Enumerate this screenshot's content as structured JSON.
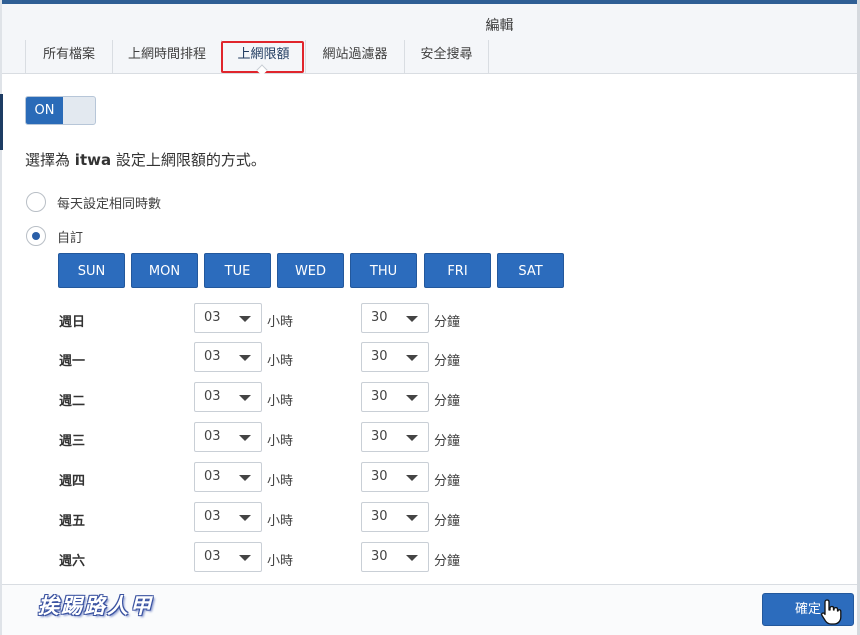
{
  "window": {
    "title": "編輯"
  },
  "tabs": [
    {
      "label": "所有檔案",
      "active": false
    },
    {
      "label": "上網時間排程",
      "active": false
    },
    {
      "label": "上網限額",
      "active": true
    },
    {
      "label": "網站過濾器",
      "active": false
    },
    {
      "label": "安全搜尋",
      "active": false
    }
  ],
  "toggle": {
    "label": "ON",
    "state": "on"
  },
  "prompt": {
    "prefix": "選擇為",
    "user": "itwa",
    "suffix": "設定上網限額的方式。"
  },
  "modes": [
    {
      "label": "每天設定相同時數",
      "checked": false
    },
    {
      "label": "自訂",
      "checked": true
    }
  ],
  "days": [
    "SUN",
    "MON",
    "TUE",
    "WED",
    "THU",
    "FRI",
    "SAT"
  ],
  "units": {
    "hours": "小時",
    "minutes": "分鐘"
  },
  "rows": [
    {
      "label": "週日",
      "hours": "03",
      "minutes": "30"
    },
    {
      "label": "週一",
      "hours": "03",
      "minutes": "30"
    },
    {
      "label": "週二",
      "hours": "03",
      "minutes": "30"
    },
    {
      "label": "週三",
      "hours": "03",
      "minutes": "30"
    },
    {
      "label": "週四",
      "hours": "03",
      "minutes": "30"
    },
    {
      "label": "週五",
      "hours": "03",
      "minutes": "30"
    },
    {
      "label": "週六",
      "hours": "03",
      "minutes": "30"
    }
  ],
  "footer": {
    "confirm_label": "確定",
    "watermark": "挨踢路人甲"
  },
  "colors": {
    "accent": "#2c6cbd",
    "highlight": "#e0252c",
    "header_bg": "#f4f6f9"
  }
}
